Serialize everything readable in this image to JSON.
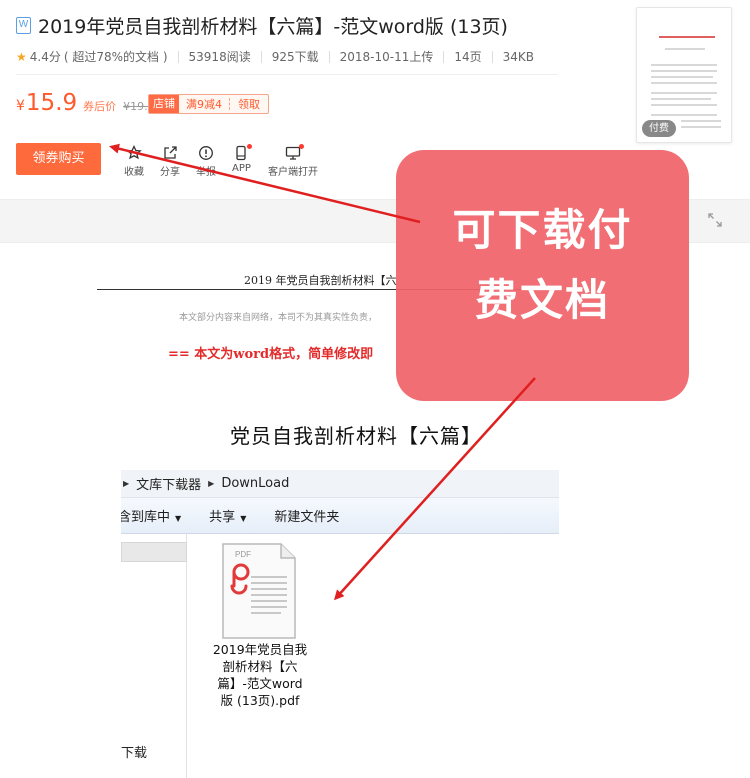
{
  "header": {
    "icon_letter": "W",
    "title": "2019年党员自我剖析材料【六篇】-范文word版 (13页)",
    "rating": "4.4分",
    "rating_note": "( 超过78%的文档 )",
    "reads": "53918阅读",
    "downloads": "925下载",
    "upload_date": "2018-10-11上传",
    "pages": "14页",
    "size": "34KB"
  },
  "price": {
    "currency": "¥",
    "value": "15.9",
    "note": "券后价",
    "original": "¥19.9"
  },
  "coupon": {
    "tag": "店铺",
    "text": "满9减4",
    "action": "领取"
  },
  "buy_button": "领券购买",
  "actions": [
    {
      "label": "收藏"
    },
    {
      "label": "分享"
    },
    {
      "label": "举报"
    },
    {
      "label": "APP"
    },
    {
      "label": "客户端打开"
    }
  ],
  "thumbnail": {
    "badge": "付费"
  },
  "document": {
    "heading": "2019 年党员自我剖析材料【六",
    "disclaimer": "本文部分内容来自网络，本司不为其真实性负责，",
    "notice": "== 本文为word格式，简单修改即",
    "main_title": "党员自我剖析材料【六篇】"
  },
  "explorer": {
    "breadcrumb": [
      "文库下载器",
      "DownLoad"
    ],
    "toolbar": [
      "包含到库中",
      "共享",
      "新建文件夹"
    ],
    "nav_item": "下载",
    "file_badge": "PDF",
    "file_name": "2019年党员自我剖析材料【六篇】-范文word版 (13页).pdf"
  },
  "overlay": {
    "line1": "可下载付",
    "line2": "费文档",
    "color": "#f0636b"
  },
  "colors": {
    "accent": "#ff6a3d",
    "price": "#ff5a2c",
    "arrow": "#e02020"
  }
}
